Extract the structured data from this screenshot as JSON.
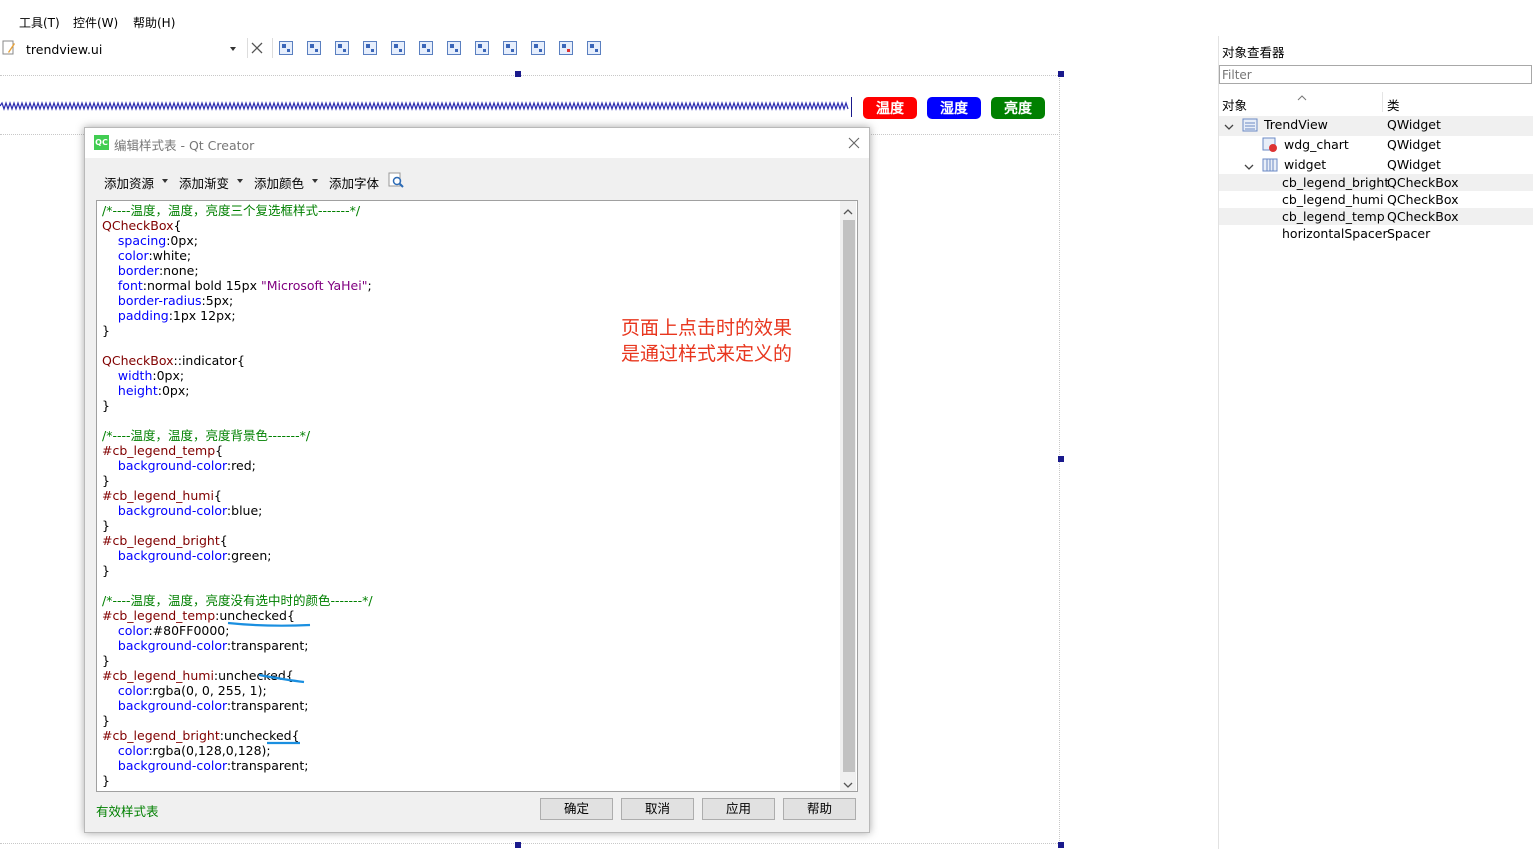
{
  "menubar": {
    "items": [
      "工具(T)",
      "控件(W)",
      "帮助(H)"
    ]
  },
  "file_toolbar": {
    "file_name": "trendview.ui",
    "icons": [
      "edit-widgets-icon",
      "edit-signals-icon",
      "edit-buddies-icon",
      "edit-taborder-icon",
      "layout-horizontal-icon",
      "layout-vertical-icon",
      "layout-hsplitter-icon",
      "layout-vsplitter-icon",
      "layout-form-icon",
      "layout-grid-icon",
      "break-layout-icon",
      "adjust-size-icon"
    ]
  },
  "preview": {
    "legend_temp": {
      "label": "温度",
      "color": "#ff0000"
    },
    "legend_humi": {
      "label": "湿度",
      "color": "#0000ff"
    },
    "legend_bright": {
      "label": "亮度",
      "color": "#008000"
    }
  },
  "object_inspector": {
    "title": "对象查看器",
    "filter_placeholder": "Filter",
    "col_object": "对象",
    "col_class": "类",
    "rows": [
      {
        "name": "TrendView",
        "class": "QWidget"
      },
      {
        "name": "wdg_chart",
        "class": "QWidget"
      },
      {
        "name": "widget",
        "class": "QWidget"
      },
      {
        "name": "cb_legend_bright",
        "class": "QCheckBox"
      },
      {
        "name": "cb_legend_humi",
        "class": "QCheckBox"
      },
      {
        "name": "cb_legend_temp",
        "class": "QCheckBox"
      },
      {
        "name": "horizontalSpacer",
        "class": "Spacer"
      }
    ]
  },
  "dialog": {
    "app_icon_label": "QC",
    "title": "编辑样式表 - Qt Creator",
    "menu": {
      "add_resource": "添加资源",
      "add_gradient": "添加渐变",
      "add_color": "添加颜色",
      "add_font": "添加字体"
    },
    "status": "有效样式表",
    "buttons": {
      "ok": "确定",
      "cancel": "取消",
      "apply": "应用",
      "help": "帮助"
    },
    "annotation": [
      "页面上点击时的效果",
      "是通过样式来定义的"
    ],
    "code_lines": [
      [
        [
          "cm",
          "/*----温度，温度，亮度三个复选框样式-------*/"
        ]
      ],
      [
        [
          "sel",
          "QCheckBox"
        ],
        [
          "val",
          "{"
        ]
      ],
      [
        [
          "val",
          "    "
        ],
        [
          "prop",
          "spacing"
        ],
        [
          "val",
          ":0px;"
        ]
      ],
      [
        [
          "val",
          "    "
        ],
        [
          "prop",
          "color"
        ],
        [
          "val",
          ":white;"
        ]
      ],
      [
        [
          "val",
          "    "
        ],
        [
          "prop",
          "border"
        ],
        [
          "val",
          ":none;"
        ]
      ],
      [
        [
          "val",
          "    "
        ],
        [
          "prop",
          "font"
        ],
        [
          "val",
          ":normal bold 15px "
        ],
        [
          "str",
          "\"Microsoft YaHei\""
        ],
        [
          "val",
          ";"
        ]
      ],
      [
        [
          "val",
          "    "
        ],
        [
          "prop",
          "border-radius"
        ],
        [
          "val",
          ":5px;"
        ]
      ],
      [
        [
          "val",
          "    "
        ],
        [
          "prop",
          "padding"
        ],
        [
          "val",
          ":1px 12px;"
        ]
      ],
      [
        [
          "val",
          "}"
        ]
      ],
      [
        [
          "val",
          ""
        ]
      ],
      [
        [
          "sel",
          "QCheckBox"
        ],
        [
          "val",
          "::indicator{"
        ]
      ],
      [
        [
          "val",
          "    "
        ],
        [
          "prop",
          "width"
        ],
        [
          "val",
          ":0px;"
        ]
      ],
      [
        [
          "val",
          "    "
        ],
        [
          "prop",
          "height"
        ],
        [
          "val",
          ":0px;"
        ]
      ],
      [
        [
          "val",
          "}"
        ]
      ],
      [
        [
          "val",
          ""
        ]
      ],
      [
        [
          "cm",
          "/*----温度，温度，亮度背景色-------*/"
        ]
      ],
      [
        [
          "sel",
          "#cb_legend_temp"
        ],
        [
          "val",
          "{"
        ]
      ],
      [
        [
          "val",
          "    "
        ],
        [
          "prop",
          "background-color"
        ],
        [
          "val",
          ":red;"
        ]
      ],
      [
        [
          "val",
          "}"
        ]
      ],
      [
        [
          "sel",
          "#cb_legend_humi"
        ],
        [
          "val",
          "{"
        ]
      ],
      [
        [
          "val",
          "    "
        ],
        [
          "prop",
          "background-color"
        ],
        [
          "val",
          ":blue;"
        ]
      ],
      [
        [
          "val",
          "}"
        ]
      ],
      [
        [
          "sel",
          "#cb_legend_bright"
        ],
        [
          "val",
          "{"
        ]
      ],
      [
        [
          "val",
          "    "
        ],
        [
          "prop",
          "background-color"
        ],
        [
          "val",
          ":green;"
        ]
      ],
      [
        [
          "val",
          "}"
        ]
      ],
      [
        [
          "val",
          ""
        ]
      ],
      [
        [
          "cm",
          "/*----温度，温度，亮度没有选中时的颜色-------*/"
        ]
      ],
      [
        [
          "sel",
          "#cb_legend_temp"
        ],
        [
          "val",
          ":unchecked{"
        ]
      ],
      [
        [
          "val",
          "    "
        ],
        [
          "prop",
          "color"
        ],
        [
          "val",
          ":#80FF0000;"
        ]
      ],
      [
        [
          "val",
          "    "
        ],
        [
          "prop",
          "background-color"
        ],
        [
          "val",
          ":transparent;"
        ]
      ],
      [
        [
          "val",
          "}"
        ]
      ],
      [
        [
          "sel",
          "#cb_legend_humi"
        ],
        [
          "val",
          ":unchecked{"
        ]
      ],
      [
        [
          "val",
          "    "
        ],
        [
          "prop",
          "color"
        ],
        [
          "val",
          ":rgba(0, 0, 255, 1);"
        ]
      ],
      [
        [
          "val",
          "    "
        ],
        [
          "prop",
          "background-color"
        ],
        [
          "val",
          ":transparent;"
        ]
      ],
      [
        [
          "val",
          "}"
        ]
      ],
      [
        [
          "sel",
          "#cb_legend_bright"
        ],
        [
          "val",
          ":unchecked{"
        ]
      ],
      [
        [
          "val",
          "    "
        ],
        [
          "prop",
          "color"
        ],
        [
          "val",
          ":rgba(0,128,0,128);"
        ]
      ],
      [
        [
          "val",
          "    "
        ],
        [
          "prop",
          "background-color"
        ],
        [
          "val",
          ":transparent;"
        ]
      ],
      [
        [
          "val",
          "}"
        ]
      ]
    ]
  }
}
